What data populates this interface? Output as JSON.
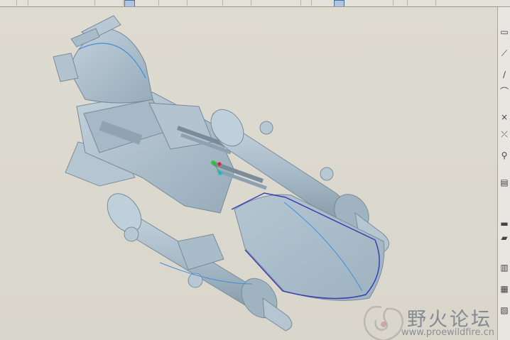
{
  "app": {
    "toolbar": {
      "buttons": [
        {
          "icon": "save-icon"
        },
        {
          "icon": "print-icon"
        },
        {
          "icon": "undo-icon"
        },
        {
          "icon": "redo-icon"
        },
        {
          "icon": "select-icon",
          "active": true
        },
        {
          "icon": "zoom-icon"
        },
        {
          "icon": "pan-icon"
        },
        {
          "icon": "rotate-icon"
        },
        {
          "icon": "datum-plane-icon"
        },
        {
          "icon": "datum-axis-icon"
        },
        {
          "icon": "datum-point-icon"
        },
        {
          "icon": "view-icon",
          "active": true
        },
        {
          "icon": "layer-icon"
        },
        {
          "icon": "shade-icon"
        },
        {
          "icon": "appearance-icon"
        }
      ]
    },
    "right_toolbar": {
      "icons": [
        "datum-plane-icon",
        "datum-axis-icon",
        "sketch-icon",
        "arc-icon",
        "datum-point-icon",
        "coordinate-system-icon",
        "analysis-icon",
        "note-icon",
        "folder-icon",
        "folder-open-icon",
        "layer-icon",
        "table-icon",
        "chart-icon"
      ]
    },
    "watermark": {
      "title": "野火论坛",
      "url": "www.proewildfire.cn"
    },
    "colors": {
      "model_fill": "#a9bcc9",
      "model_shade": "#8ea2b0",
      "edge_highlight": "#3b3fb0",
      "curve": "#3e8ee0"
    }
  }
}
